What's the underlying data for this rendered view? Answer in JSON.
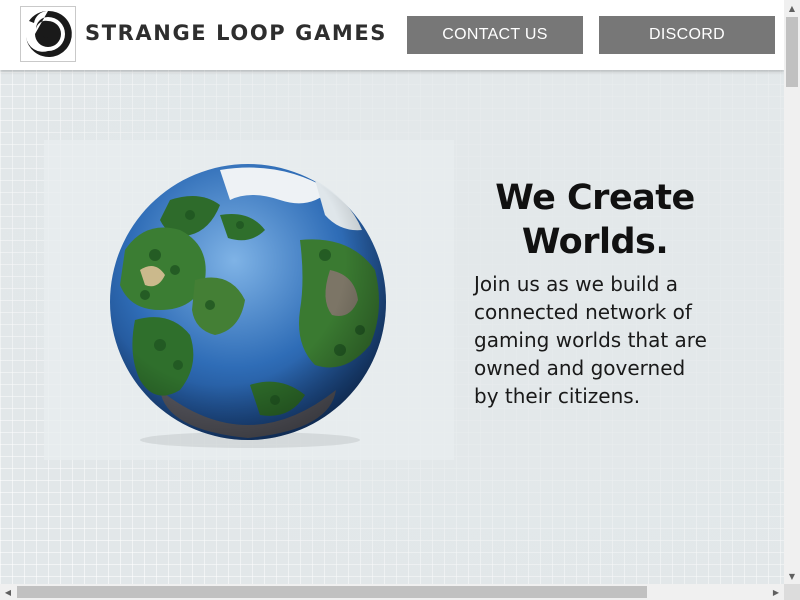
{
  "header": {
    "brand_name": "STRANGE LOOP GAMES",
    "logo_icon": "spiral-logo-icon",
    "nav": [
      {
        "label": "CONTACT US"
      },
      {
        "label": "DISCORD"
      }
    ]
  },
  "hero": {
    "headline_line1": "We Create",
    "headline_line2": "Worlds.",
    "body": "Join us as we build a connected network of gaming worlds that are owned and governed by their citizens.",
    "image_icon": "planet-globe-image"
  },
  "colors": {
    "header_bg": "#ffffff",
    "button_bg": "#777777",
    "button_text": "#ffffff",
    "page_bg": "#e2e7e9",
    "text": "#111111"
  },
  "scrollbars": {
    "up_arrow": "▲",
    "down_arrow": "▼",
    "left_arrow": "◀",
    "right_arrow": "▶"
  }
}
